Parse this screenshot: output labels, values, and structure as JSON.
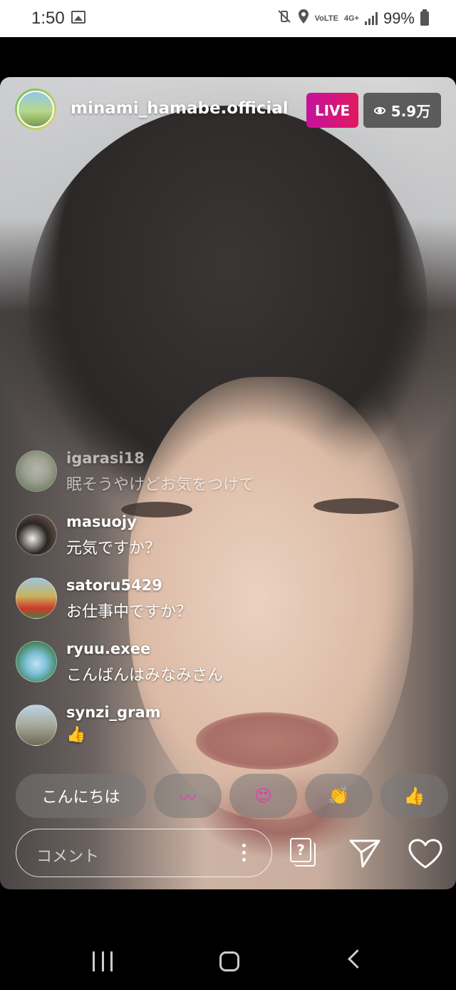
{
  "status_bar": {
    "time": "1:50",
    "icons": [
      "image-icon",
      "mute-vibrate-icon",
      "location-icon",
      "volte-icon",
      "4g-icon",
      "signal-icon",
      "battery-icon"
    ],
    "volte": "VoLTE",
    "network": "4G+",
    "battery": "99%"
  },
  "live": {
    "username": "minami_hamabe.official",
    "badge": "LIVE",
    "viewers": "5.9万"
  },
  "comments": [
    {
      "user": "igarasi18",
      "text": "眠そうやけどお気をつけて"
    },
    {
      "user": "masuojy",
      "text": "元気ですか？"
    },
    {
      "user": "satoru5429",
      "text": "お仕事中ですか？"
    },
    {
      "user": "ryuu.exee",
      "text": "こんばんはみなみさん"
    },
    {
      "user": "synzi_gram",
      "text": "👍"
    }
  ],
  "quick_reactions": [
    "こんにちは",
    "〰",
    "😍",
    "👏",
    "👍"
  ],
  "input": {
    "placeholder": "コメント"
  },
  "colors": {
    "live_gradient_start": "#c4129c",
    "live_gradient_end": "#e0195f",
    "reaction_pink": "#e040b0",
    "reaction_orange": "#f0a030"
  }
}
